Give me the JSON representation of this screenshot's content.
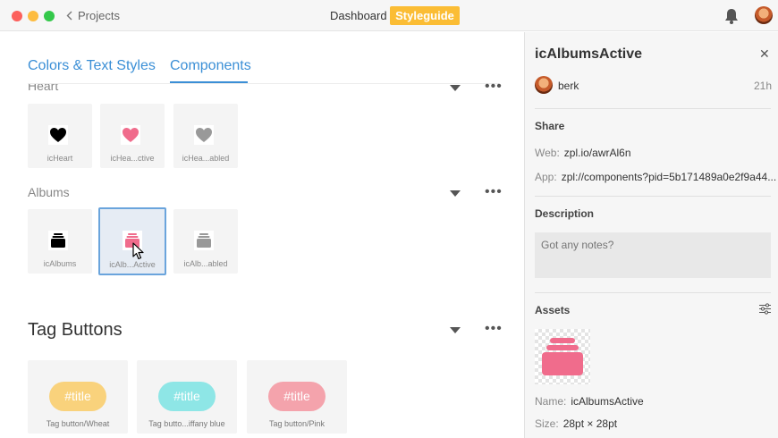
{
  "app": {
    "back_label": "Projects",
    "nav_dashboard": "Dashboard",
    "nav_styleguide": "Styleguide"
  },
  "tabs": [
    "Colors & Text Styles",
    "Components"
  ],
  "sections": {
    "heart": {
      "title": "Heart",
      "items": [
        {
          "label": "icHeart",
          "color": "#000000"
        },
        {
          "label": "icHea...ctive",
          "color": "#f06c8c"
        },
        {
          "label": "icHea...abled",
          "color": "#999999"
        }
      ]
    },
    "albums": {
      "title": "Albums",
      "items": [
        {
          "label": "icAlbums",
          "color": "#000000"
        },
        {
          "label": "icAlb...Active",
          "color": "#f06c8c"
        },
        {
          "label": "icAlb...abled",
          "color": "#999999"
        }
      ]
    },
    "tag_buttons": {
      "title": "Tag Buttons",
      "items": [
        {
          "text": "#title",
          "label": "Tag button/Wheat",
          "color": "#f9d27c"
        },
        {
          "text": "#title",
          "label": "Tag butto...iffany blue",
          "color": "#8ee6e6"
        },
        {
          "text": "#title",
          "label": "Tag button/Pink",
          "color": "#f4a3ac"
        }
      ]
    }
  },
  "detail": {
    "title": "icAlbumsActive",
    "user": "berk",
    "time": "21h",
    "share_heading": "Share",
    "web_key": "Web:",
    "web_value": "zpl.io/awrAl6n",
    "app_key": "App:",
    "app_value": "zpl://components?pid=5b171489a0e2f9a44...",
    "description_heading": "Description",
    "notes_placeholder": "Got any notes?",
    "assets_heading": "Assets",
    "name_key": "Name:",
    "name_value": "icAlbumsActive",
    "size_key": "Size:",
    "size_value": "28pt × 28pt"
  },
  "colors": {
    "accent": "#3b8fd6",
    "styleguide": "#fbbd35",
    "asset": "#f06c8c"
  },
  "icons": [
    "chevron-left-icon",
    "bell-icon",
    "caret-down-icon",
    "more-icon",
    "close-icon",
    "settings-sliders-icon",
    "heart-icon",
    "albums-icon",
    "cursor-icon"
  ]
}
